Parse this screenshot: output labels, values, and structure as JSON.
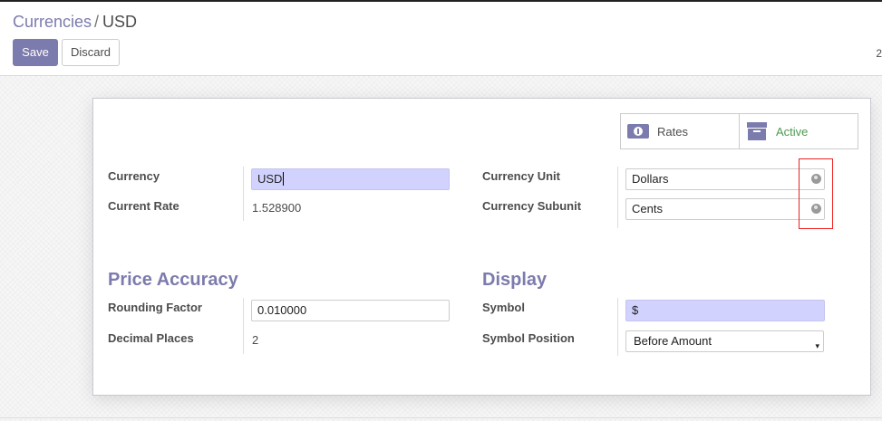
{
  "breadcrumb": {
    "parent": "Currencies",
    "separator": "/",
    "current": "USD"
  },
  "toolbar": {
    "save_label": "Save",
    "discard_label": "Discard"
  },
  "pager": {
    "text": "2"
  },
  "smart_buttons": [
    {
      "label": "Rates",
      "icon": "money-icon"
    },
    {
      "label": "Active",
      "icon": "archive-icon",
      "color": "#4e9a4e"
    }
  ],
  "fields": {
    "currency": {
      "label": "Currency",
      "value": "USD"
    },
    "current_rate": {
      "label": "Current Rate",
      "value": "1.528900"
    },
    "currency_unit": {
      "label": "Currency Unit",
      "value": "Dollars"
    },
    "currency_subunit": {
      "label": "Currency Subunit",
      "value": "Cents"
    },
    "rounding_factor": {
      "label": "Rounding Factor",
      "value": "0.010000"
    },
    "decimal_places": {
      "label": "Decimal Places",
      "value": "2"
    },
    "symbol": {
      "label": "Symbol",
      "value": "$"
    },
    "symbol_position": {
      "label": "Symbol Position",
      "value": "Before Amount"
    }
  },
  "sections": {
    "price_accuracy": "Price Accuracy",
    "display": "Display"
  },
  "colors": {
    "primary": "#7c7bad",
    "required_bg": "#d2d2ff",
    "active_green": "#4e9a4e",
    "highlight": "#ee2222"
  }
}
